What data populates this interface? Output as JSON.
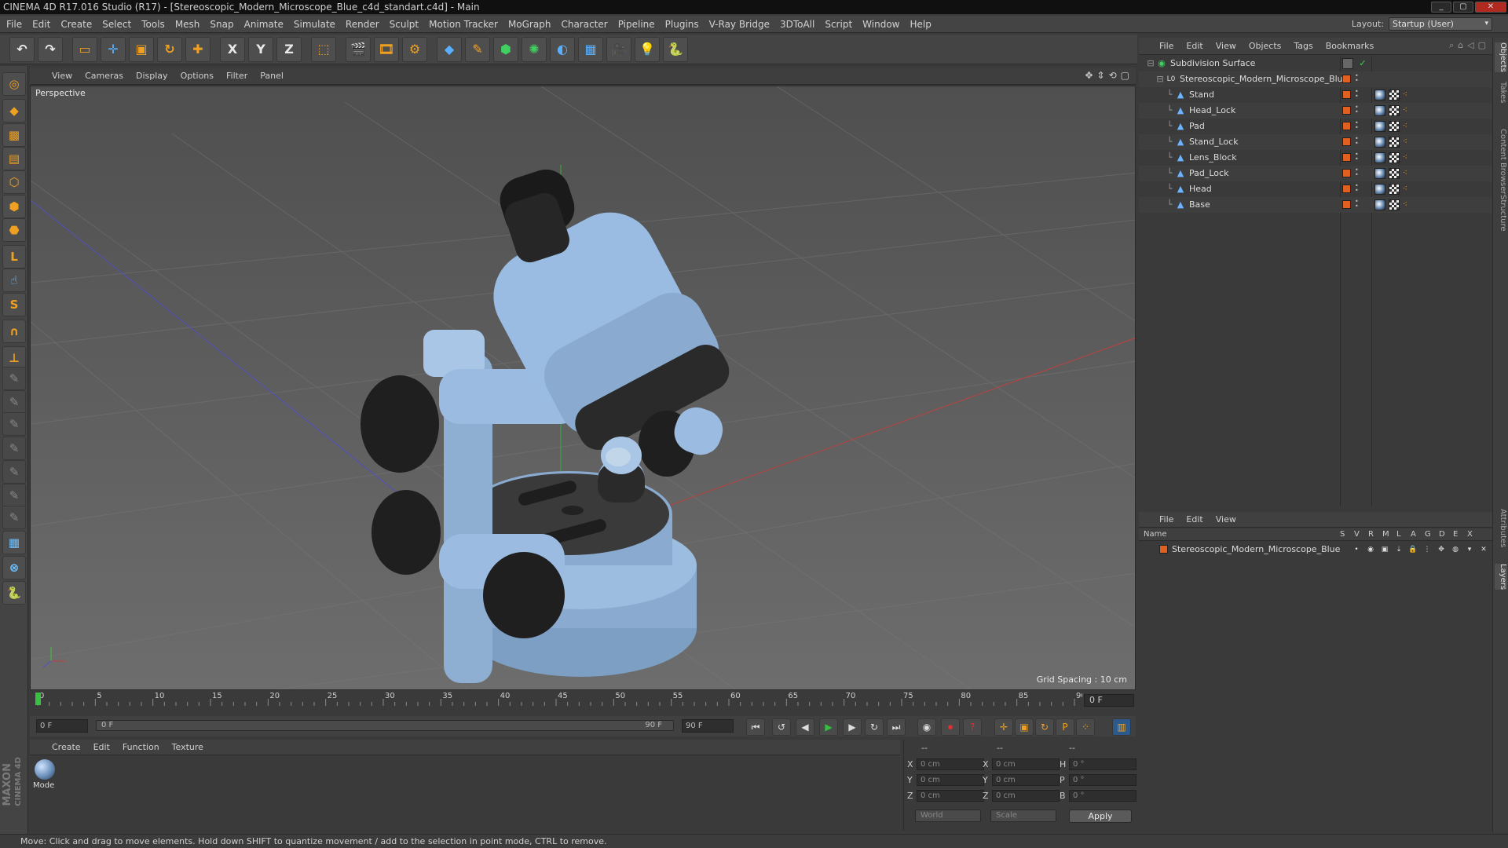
{
  "window": {
    "title": "CINEMA 4D R17.016 Studio (R17) - [Stereoscopic_Modern_Microscope_Blue_c4d_standart.c4d] - Main",
    "buttons": [
      "_",
      "▢",
      "✕"
    ]
  },
  "menubar": {
    "items": [
      "File",
      "Edit",
      "Create",
      "Select",
      "Tools",
      "Mesh",
      "Snap",
      "Animate",
      "Simulate",
      "Render",
      "Sculpt",
      "Motion Tracker",
      "MoGraph",
      "Character",
      "Pipeline",
      "Plugins",
      "V-Ray Bridge",
      "3DToAll",
      "Script",
      "Window",
      "Help"
    ],
    "layout_label": "Layout:",
    "layout_value": "Startup (User)"
  },
  "toolbar": {
    "icons": [
      {
        "name": "undo-icon",
        "glyph": "↶"
      },
      {
        "name": "redo-icon",
        "glyph": "↷"
      },
      {
        "name": "live-selection-icon",
        "glyph": "▭"
      },
      {
        "name": "move-icon",
        "glyph": "✛"
      },
      {
        "name": "scale-icon",
        "glyph": "▣"
      },
      {
        "name": "rotate-icon",
        "glyph": "↻"
      },
      {
        "name": "last-tool-icon",
        "glyph": "✚"
      },
      {
        "name": "x-axis-icon",
        "glyph": "X"
      },
      {
        "name": "y-axis-icon",
        "glyph": "Y"
      },
      {
        "name": "z-axis-icon",
        "glyph": "Z"
      },
      {
        "name": "coordinate-system-icon",
        "glyph": "⬚"
      },
      {
        "name": "render-view-icon",
        "glyph": "🎬"
      },
      {
        "name": "render-picture-viewer-icon",
        "glyph": "🎞"
      },
      {
        "name": "render-settings-icon",
        "glyph": "⚙"
      },
      {
        "name": "cube-icon",
        "glyph": "◆"
      },
      {
        "name": "spline-pen-icon",
        "glyph": "✎"
      },
      {
        "name": "subdivision-icon",
        "glyph": "⬢"
      },
      {
        "name": "array-icon",
        "glyph": "✺"
      },
      {
        "name": "deformer-icon",
        "glyph": "◐"
      },
      {
        "name": "floor-icon",
        "glyph": "▦"
      },
      {
        "name": "camera-icon",
        "glyph": "🎥"
      },
      {
        "name": "light-icon",
        "glyph": "💡"
      },
      {
        "name": "python-icon",
        "glyph": "🐍"
      }
    ]
  },
  "leftbar": {
    "icons": [
      {
        "name": "make-editable-icon",
        "glyph": "◎"
      },
      {
        "name": "model-mode-icon",
        "glyph": "◆"
      },
      {
        "name": "texture-mode-icon",
        "glyph": "▩"
      },
      {
        "name": "workplane-icon",
        "glyph": "▤"
      },
      {
        "name": "points-mode-icon",
        "glyph": "⬡"
      },
      {
        "name": "edges-mode-icon",
        "glyph": "⬢"
      },
      {
        "name": "polygons-mode-icon",
        "glyph": "⬣"
      },
      {
        "name": "axis-mode-icon",
        "glyph": "L"
      },
      {
        "name": "tweak-mode-icon",
        "glyph": "☝"
      },
      {
        "name": "snap-icon",
        "glyph": "S"
      },
      {
        "name": "magnet-icon",
        "glyph": "∩"
      },
      {
        "name": "locked-workplane-icon",
        "glyph": "⊥"
      },
      {
        "name": "sculpt-brush-1-icon",
        "glyph": "✎"
      },
      {
        "name": "sculpt-brush-2-icon",
        "glyph": "✎"
      },
      {
        "name": "sculpt-brush-3-icon",
        "glyph": "✎"
      },
      {
        "name": "sculpt-brush-4-icon",
        "glyph": "✎"
      },
      {
        "name": "sculpt-brush-5-icon",
        "glyph": "✎"
      },
      {
        "name": "sculpt-brush-6-icon",
        "glyph": "✎"
      },
      {
        "name": "sculpt-brush-7-icon",
        "glyph": "✎"
      },
      {
        "name": "checker-icon",
        "glyph": "▦"
      },
      {
        "name": "grid-lock-icon",
        "glyph": "⊗"
      },
      {
        "name": "python-script-icon",
        "glyph": "🐍"
      }
    ]
  },
  "viewport": {
    "menu": [
      "View",
      "Cameras",
      "Display",
      "Options",
      "Filter",
      "Panel"
    ],
    "label": "Perspective",
    "grid_spacing": "Grid Spacing : 10 cm",
    "nav_icons": [
      "✥",
      "⇕",
      "⟲",
      "▢"
    ]
  },
  "timeline": {
    "ticks": [
      "0",
      "5",
      "10",
      "15",
      "20",
      "25",
      "30",
      "35",
      "40",
      "45",
      "50",
      "55",
      "60",
      "65",
      "70",
      "75",
      "80",
      "85",
      "90"
    ],
    "current_frame": "0 F",
    "start_field": "0 F",
    "slider_start": "0 F",
    "slider_end": "90 F",
    "end_field": "90 F"
  },
  "transport": {
    "buttons": [
      {
        "name": "go-to-start-icon",
        "glyph": "⏮"
      },
      {
        "name": "prev-key-icon",
        "glyph": "↺"
      },
      {
        "name": "prev-frame-icon",
        "glyph": "◀"
      },
      {
        "name": "play-icon",
        "glyph": "▶"
      },
      {
        "name": "next-frame-icon",
        "glyph": "▶"
      },
      {
        "name": "next-key-icon",
        "glyph": "↻"
      },
      {
        "name": "go-to-end-icon",
        "glyph": "⏭"
      },
      {
        "name": "record-icon",
        "glyph": "◉"
      },
      {
        "name": "autokey-icon",
        "glyph": "⏺"
      },
      {
        "name": "keyframe-help-icon",
        "glyph": "?"
      },
      {
        "name": "key-move-icon",
        "glyph": "✛"
      },
      {
        "name": "key-scale-icon",
        "glyph": "▣"
      },
      {
        "name": "key-rotate-icon",
        "glyph": "↻"
      },
      {
        "name": "key-param-icon",
        "glyph": "P"
      },
      {
        "name": "key-pla-icon",
        "glyph": "⁘"
      },
      {
        "name": "timeline-icon",
        "glyph": "▥"
      }
    ]
  },
  "material_manager": {
    "menu": [
      "Create",
      "Edit",
      "Function",
      "Texture"
    ],
    "material_name": "Mode"
  },
  "coordinates": {
    "header": [
      "--",
      "--",
      "--"
    ],
    "rows": [
      {
        "l1": "X",
        "v1": "0 cm",
        "l2": "X",
        "v2": "0 cm",
        "l3": "H",
        "v3": "0 °"
      },
      {
        "l1": "Y",
        "v1": "0 cm",
        "l2": "Y",
        "v2": "0 cm",
        "l3": "P",
        "v3": "0 °"
      },
      {
        "l1": "Z",
        "v1": "0 cm",
        "l2": "Z",
        "v2": "0 cm",
        "l3": "B",
        "v3": "0 °"
      }
    ],
    "mode": "World",
    "transform": "Scale",
    "apply_label": "Apply"
  },
  "object_manager": {
    "menu": [
      "File",
      "Edit",
      "View",
      "Objects",
      "Tags",
      "Bookmarks"
    ],
    "objects": [
      {
        "name": "Subdivision Surface",
        "level": 0,
        "icon": "subdivision-surface-icon",
        "glyph": "◉",
        "color": "#40d060"
      },
      {
        "name": "Stereoscopic_Modern_Microscope_Blue",
        "level": 1,
        "icon": "null-object-icon",
        "glyph": "L0",
        "color": "#ddd"
      },
      {
        "name": "Stand",
        "level": 2,
        "icon": "polygon-object-icon",
        "glyph": "▲",
        "color": "#6cb4ff"
      },
      {
        "name": "Head_Lock",
        "level": 2,
        "icon": "polygon-object-icon",
        "glyph": "▲",
        "color": "#6cb4ff"
      },
      {
        "name": "Pad",
        "level": 2,
        "icon": "polygon-object-icon",
        "glyph": "▲",
        "color": "#6cb4ff"
      },
      {
        "name": "Stand_Lock",
        "level": 2,
        "icon": "polygon-object-icon",
        "glyph": "▲",
        "color": "#6cb4ff"
      },
      {
        "name": "Lens_Block",
        "level": 2,
        "icon": "polygon-object-icon",
        "glyph": "▲",
        "color": "#6cb4ff"
      },
      {
        "name": "Pad_Lock",
        "level": 2,
        "icon": "polygon-object-icon",
        "glyph": "▲",
        "color": "#6cb4ff"
      },
      {
        "name": "Head",
        "level": 2,
        "icon": "polygon-object-icon",
        "glyph": "▲",
        "color": "#6cb4ff"
      },
      {
        "name": "Base",
        "level": 2,
        "icon": "polygon-object-icon",
        "glyph": "▲",
        "color": "#6cb4ff"
      }
    ]
  },
  "layer_manager": {
    "menu": [
      "File",
      "Edit",
      "View"
    ],
    "columns": [
      "Name",
      "S",
      "V",
      "R",
      "M",
      "L",
      "A",
      "G",
      "D",
      "E",
      "X"
    ],
    "layers": [
      {
        "name": "Stereoscopic_Modern_Microscope_Blue",
        "color": "#e06020"
      }
    ]
  },
  "right_tabs": [
    "Objects",
    "Takes",
    "Content Browser",
    "Structure",
    "Attributes",
    "Layers"
  ],
  "brand": {
    "line1": "MAXON",
    "line2": "CINEMA 4D"
  },
  "status": "Move: Click and drag to move elements. Hold down SHIFT to quantize movement / add to the selection in point mode, CTRL to remove.",
  "colors": {
    "model_blue": "#8fb2d8",
    "model_dark": "#262626",
    "accent_orange": "#f0a020",
    "selection_orange": "#e06020"
  }
}
